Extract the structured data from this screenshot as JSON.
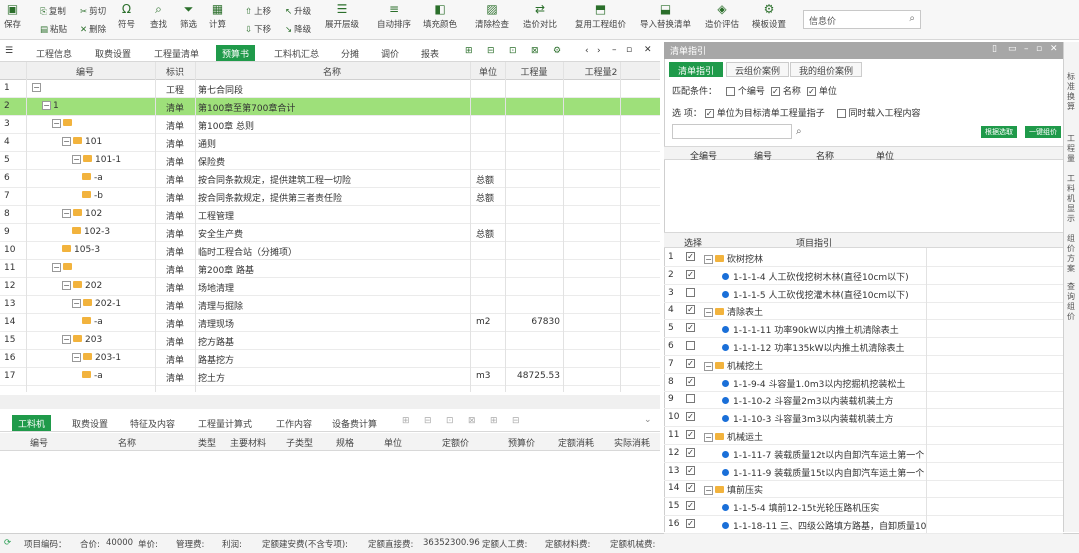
{
  "toolbar": {
    "save": "保存",
    "copy": "复制",
    "cut": "剪切",
    "paste": "粘贴",
    "delete": "删除",
    "symbol": "符号",
    "find": "查找",
    "filter": "筛选",
    "calc": "计算",
    "up": "上移",
    "down": "下移",
    "upgrade": "升级",
    "downgrade": "降级",
    "expand": "展开层级",
    "autocode": "自动排序",
    "fill_color": "填充颜色",
    "clean": "清除检查",
    "compare": "造价对比",
    "import_eng": "复用工程组价",
    "replace_list": "导入替换清单",
    "eval": "造价评估",
    "template": "模板设置",
    "search_placeholder": "信息价"
  },
  "tabs": [
    "工程信息",
    "取费设置",
    "工程量清单",
    "预算书",
    "工料机汇总",
    "分摊",
    "调价",
    "报表"
  ],
  "grid": {
    "headers": [
      "编号",
      "标识",
      "名称",
      "单位",
      "工程量",
      "工程量2"
    ],
    "rows": [
      {
        "no": "1",
        "code": "",
        "flag": "工程",
        "name": "第七合同段",
        "unit": "",
        "qty": "",
        "level": 0,
        "fold": "−",
        "folder": false,
        "sel": false
      },
      {
        "no": "2",
        "code": "1",
        "flag": "清单",
        "name": "第100章至第700章合计",
        "unit": "",
        "qty": "",
        "level": 1,
        "fold": "−",
        "folder": false,
        "sel": true
      },
      {
        "no": "3",
        "code": "",
        "flag": "清单",
        "name": "第100章 总则",
        "unit": "",
        "qty": "",
        "level": 2,
        "fold": "−",
        "folder": true,
        "sel": false
      },
      {
        "no": "4",
        "code": "101",
        "flag": "清单",
        "name": "通则",
        "unit": "",
        "qty": "",
        "level": 3,
        "fold": "−",
        "folder": true,
        "sel": false
      },
      {
        "no": "5",
        "code": "101-1",
        "flag": "清单",
        "name": "保险费",
        "unit": "",
        "qty": "",
        "level": 4,
        "fold": "−",
        "folder": true,
        "sel": false
      },
      {
        "no": "6",
        "code": "-a",
        "flag": "清单",
        "name": "按合同条款规定，提供建筑工程一切险",
        "unit": "总额",
        "qty": "",
        "level": 5,
        "fold": "",
        "folder": true,
        "sel": false
      },
      {
        "no": "7",
        "code": "-b",
        "flag": "清单",
        "name": "按合同条款规定，提供第三者责任险",
        "unit": "总额",
        "qty": "",
        "level": 5,
        "fold": "",
        "folder": true,
        "sel": false
      },
      {
        "no": "8",
        "code": "102",
        "flag": "清单",
        "name": "工程管理",
        "unit": "",
        "qty": "",
        "level": 3,
        "fold": "−",
        "folder": true,
        "sel": false
      },
      {
        "no": "9",
        "code": "102-3",
        "flag": "清单",
        "name": "安全生产费",
        "unit": "总额",
        "qty": "",
        "level": 4,
        "fold": "",
        "folder": true,
        "sel": false
      },
      {
        "no": "10",
        "code": "105-3",
        "flag": "清单",
        "name": "临时工程合站（分摊项）",
        "unit": "",
        "qty": "",
        "level": 3,
        "fold": "",
        "folder": true,
        "sel": false
      },
      {
        "no": "11",
        "code": "",
        "flag": "清单",
        "name": "第200章 路基",
        "unit": "",
        "qty": "",
        "level": 2,
        "fold": "−",
        "folder": true,
        "sel": false
      },
      {
        "no": "12",
        "code": "202",
        "flag": "清单",
        "name": "场地清理",
        "unit": "",
        "qty": "",
        "level": 3,
        "fold": "−",
        "folder": true,
        "sel": false
      },
      {
        "no": "13",
        "code": "202-1",
        "flag": "清单",
        "name": "清理与掘除",
        "unit": "",
        "qty": "",
        "level": 4,
        "fold": "−",
        "folder": true,
        "sel": false
      },
      {
        "no": "14",
        "code": "-a",
        "flag": "清单",
        "name": "清理现场",
        "unit": "m2",
        "qty": "67830",
        "level": 5,
        "fold": "",
        "folder": true,
        "sel": false
      },
      {
        "no": "15",
        "code": "203",
        "flag": "清单",
        "name": "挖方路基",
        "unit": "",
        "qty": "",
        "level": 3,
        "fold": "−",
        "folder": true,
        "sel": false
      },
      {
        "no": "16",
        "code": "203-1",
        "flag": "清单",
        "name": "路基挖方",
        "unit": "",
        "qty": "",
        "level": 4,
        "fold": "−",
        "folder": true,
        "sel": false
      },
      {
        "no": "17",
        "code": "-a",
        "flag": "清单",
        "name": "挖土方",
        "unit": "m3",
        "qty": "48725.53",
        "level": 5,
        "fold": "",
        "folder": true,
        "sel": false
      }
    ]
  },
  "bottom_tabs": [
    "工料机",
    "取费设置",
    "特征及内容",
    "工程量计算式",
    "工作内容",
    "设备费计算"
  ],
  "bottom_headers": [
    "编号",
    "名称",
    "类型",
    "主要材料",
    "子类型",
    "规格",
    "单位",
    "定额价",
    "预算价",
    "定额消耗",
    "实际消耗"
  ],
  "status": {
    "project": "项目编码：",
    "total_label": "合价:",
    "total": "40000",
    "price": "单价:",
    "mgmt": "管理费:",
    "profit": "利润:",
    "fee_a": "定额建安费(不含专项):",
    "direct_label": "定额直接费:",
    "direct": "36352300.96",
    "labor": "定额人工费:",
    "material": "定额材料费:",
    "machine": "定额机械费:"
  },
  "right": {
    "title": "清单指引",
    "tabs": [
      "清单指引",
      "云组价案例",
      "我的组价案例"
    ],
    "match_label": "匹配条件：",
    "match_opts": [
      "个编号",
      "名称",
      "单位"
    ],
    "match_checked": [
      false,
      true,
      true
    ],
    "option_label": "选    项：",
    "option1": "单位为目标清单工程量指子",
    "option2": "同时载入工程内容",
    "btn1": "根据选取",
    "btn2": "一键组价",
    "upper_headers": [
      "全编号",
      "编号",
      "名称",
      "单位"
    ],
    "lower_headers": [
      "选择",
      "项目指引"
    ],
    "rows": [
      {
        "no": "1",
        "checked": true,
        "folder": true,
        "text": "砍树挖林",
        "level": 0
      },
      {
        "no": "2",
        "checked": true,
        "folder": false,
        "text": "1-1-1-4 人工砍伐挖树木林(直径10cm以下)",
        "level": 1
      },
      {
        "no": "3",
        "checked": false,
        "folder": false,
        "text": "1-1-1-5 人工砍伐挖灌木林(直径10cm以下)",
        "level": 1
      },
      {
        "no": "4",
        "checked": true,
        "folder": true,
        "text": "清除表土",
        "level": 0
      },
      {
        "no": "5",
        "checked": true,
        "folder": false,
        "text": "1-1-1-11 功率90kW以内推土机清除表土",
        "level": 1
      },
      {
        "no": "6",
        "checked": false,
        "folder": false,
        "text": "1-1-1-12 功率135kW以内推土机清除表土",
        "level": 1
      },
      {
        "no": "7",
        "checked": true,
        "folder": true,
        "text": "机械挖土",
        "level": 0
      },
      {
        "no": "8",
        "checked": true,
        "folder": false,
        "text": "1-1-9-4 斗容量1.0m3以内挖掘机挖装松土",
        "level": 1
      },
      {
        "no": "9",
        "checked": false,
        "folder": false,
        "text": "1-1-10-2 斗容量2m3以内装载机装土方",
        "level": 1
      },
      {
        "no": "10",
        "checked": true,
        "folder": false,
        "text": "1-1-10-3 斗容量3m3以内装载机装土方",
        "level": 1
      },
      {
        "no": "11",
        "checked": true,
        "folder": true,
        "text": "机械运土",
        "level": 0
      },
      {
        "no": "12",
        "checked": true,
        "folder": false,
        "text": "1-1-11-7 装载质量12t以内自卸汽车运土第一个",
        "level": 1
      },
      {
        "no": "13",
        "checked": true,
        "folder": false,
        "text": "1-1-11-9 装载质量15t以内自卸汽车运土第一个",
        "level": 1
      },
      {
        "no": "14",
        "checked": true,
        "folder": true,
        "text": "填前压实",
        "level": 0
      },
      {
        "no": "15",
        "checked": true,
        "folder": false,
        "text": "1-1-5-4 填前12-15t光轮压路机压实",
        "level": 1
      },
      {
        "no": "16",
        "checked": true,
        "folder": false,
        "text": "1-1-18-11 三、四级公路填方路基，自卸质量10",
        "level": 1
      }
    ]
  },
  "side_tabs": [
    "标准换算",
    "工程量",
    "工料机显示",
    "组价方案",
    "查询组价"
  ]
}
